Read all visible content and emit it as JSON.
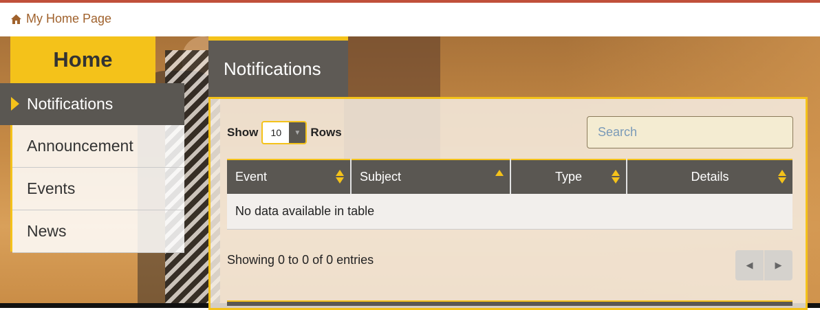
{
  "topbar": {
    "home_label": "My Home Page",
    "icon": "home-icon"
  },
  "sidebar": {
    "heading": "Home",
    "items": [
      {
        "label": "Notifications",
        "active": true
      },
      {
        "label": "Announcement"
      },
      {
        "label": "Events"
      },
      {
        "label": "News"
      }
    ]
  },
  "panel": {
    "title": "Notifications",
    "show_label": "Show",
    "rows_value": "10",
    "rows_label": "Rows",
    "search_placeholder": "Search",
    "columns": [
      "Event",
      "Subject",
      "Type",
      "Details"
    ],
    "empty_message": "No data available in table",
    "info": "Showing 0 to 0 of 0 entries"
  },
  "colors": {
    "accent": "#f4c21a",
    "dark": "#5a5752",
    "link": "#a0622d"
  }
}
